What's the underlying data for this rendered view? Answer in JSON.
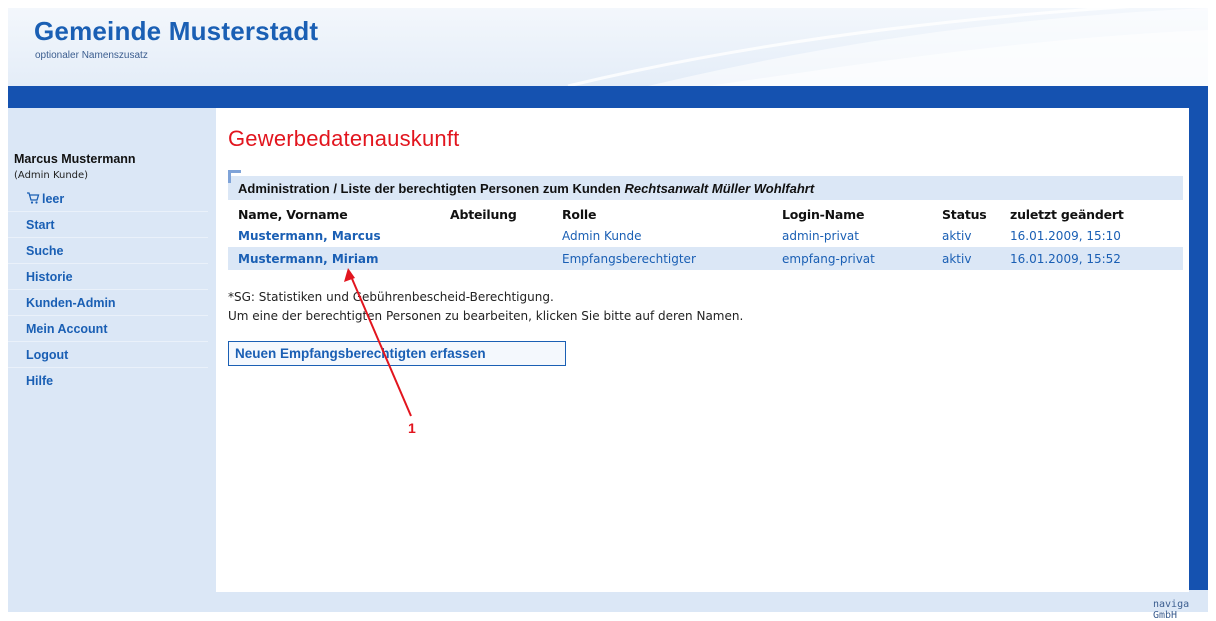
{
  "header": {
    "title": "Gemeinde Musterstadt",
    "subtitle": "optionaler Namenszusatz"
  },
  "sidebar": {
    "user_name": "Marcus Mustermann",
    "user_role": "(Admin Kunde)",
    "cart_label": "leer",
    "items": [
      {
        "label": "Start"
      },
      {
        "label": "Suche"
      },
      {
        "label": "Historie"
      },
      {
        "label": "Kunden-Admin"
      },
      {
        "label": "Mein Account"
      },
      {
        "label": "Logout"
      },
      {
        "label": "Hilfe"
      }
    ]
  },
  "main": {
    "page_title": "Gewerbedatenauskunft",
    "section_title_prefix": "Administration / Liste der berechtigten Personen zum Kunden ",
    "section_title_customer": "Rechtsanwalt Müller Wohlfahrt",
    "table": {
      "headers": [
        "Name, Vorname",
        "Abteilung",
        "Rolle",
        "Login-Name",
        "Status",
        "zuletzt geändert"
      ],
      "rows": [
        {
          "name": "Mustermann, Marcus",
          "abteilung": "",
          "rolle": "Admin Kunde",
          "login": "admin-privat",
          "status": "aktiv",
          "changed": "16.01.2009, 15:10"
        },
        {
          "name": "Mustermann, Miriam",
          "abteilung": "",
          "rolle": "Empfangsberechtigter",
          "login": "empfang-privat",
          "status": "aktiv",
          "changed": "16.01.2009, 15:52"
        }
      ]
    },
    "note_1": "*SG: Statistiken und Gebührenbescheid-Berechtigung.",
    "note_2": "Um eine der berechtigten Personen zu bearbeiten, klicken Sie bitte auf deren Namen.",
    "new_button_label": "Neuen Empfangsberechtigten erfassen",
    "annotation_label": "1"
  },
  "footer": {
    "credit": "naviga GmbH"
  },
  "colors": {
    "brand_blue": "#1a5fb4",
    "bar_blue": "#1552b0",
    "title_red": "#e2151e",
    "panel_blue": "#dbe7f6"
  }
}
